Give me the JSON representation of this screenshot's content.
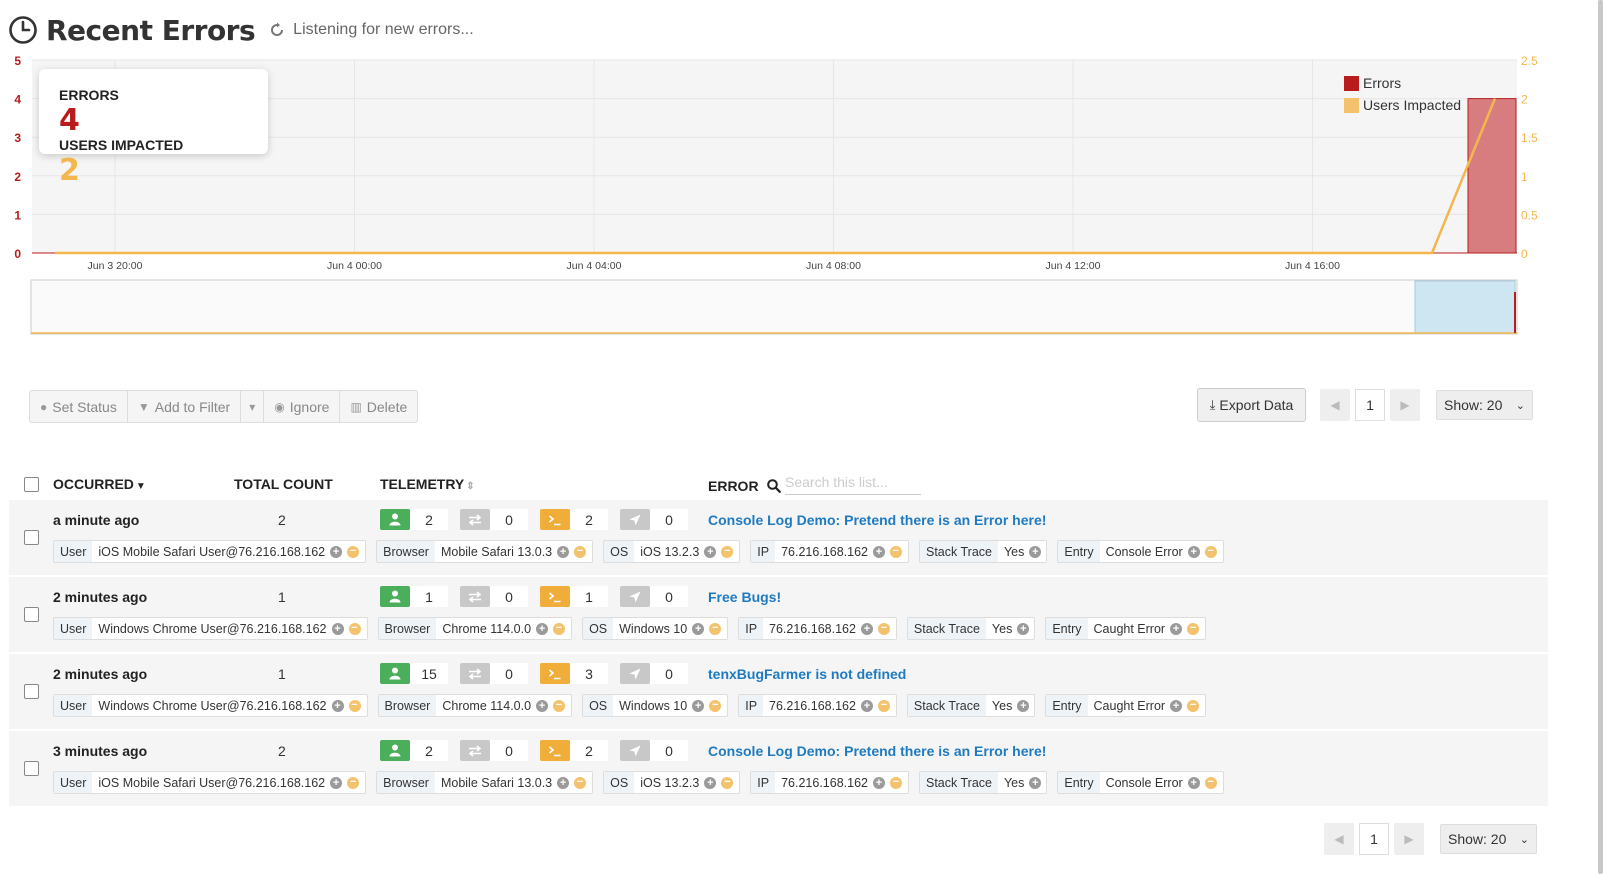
{
  "header": {
    "title": "Recent Errors",
    "status": "Listening for new errors..."
  },
  "stats": {
    "errors_label": "ERRORS",
    "errors_value": "4",
    "users_label": "USERS IMPACTED",
    "users_value": "2"
  },
  "colors": {
    "errors": "#b81c1c",
    "users": "#f4b64f",
    "link": "#1f7bc1",
    "user_badge": "#4aae5b",
    "orange_badge": "#f0ad3a",
    "gray_badge": "#c8c8c8"
  },
  "chart_data": {
    "type": "bar",
    "x": [
      "Jun 3 20:00",
      "Jun 4 00:00",
      "Jun 4 04:00",
      "Jun 4 08:00",
      "Jun 4 12:00",
      "Jun 4 16:00"
    ],
    "y_left_ticks": [
      "0",
      "1",
      "2",
      "3",
      "4",
      "5"
    ],
    "y_right_ticks": [
      "0",
      "0.5",
      "1",
      "1.5",
      "2",
      "2.5"
    ],
    "ylim_left": [
      0,
      5
    ],
    "ylim_right": [
      0,
      2.5
    ],
    "series": [
      {
        "name": "Errors",
        "type": "bar",
        "values": [
          0,
          0,
          0,
          0,
          0,
          4
        ],
        "axis": "left"
      },
      {
        "name": "Users Impacted",
        "type": "line",
        "values": [
          0,
          0,
          0,
          0,
          0,
          2
        ],
        "axis": "right"
      }
    ],
    "legend_position": "top-right",
    "grid": true
  },
  "legend": {
    "errors": "Errors",
    "users": "Users Impacted"
  },
  "toolbar": {
    "set_status": "Set Status",
    "add_to_filter": "Add to Filter",
    "ignore": "Ignore",
    "delete": "Delete",
    "export": "Export Data"
  },
  "pager": {
    "page": "1",
    "show": "Show: 20"
  },
  "table": {
    "col_occurred": "OCCURRED",
    "col_total": "TOTAL COUNT",
    "col_telemetry": "TELEMETRY",
    "col_error": "ERROR",
    "search_placeholder": "Search this list...",
    "rows": [
      {
        "occurred": "a minute ago",
        "count": "2",
        "t_user": "2",
        "t_net": "0",
        "t_console": "2",
        "t_nav": "0",
        "error": "Console Log Demo: Pretend there is an Error here!",
        "user_k": "User",
        "user_v": "iOS Mobile Safari User@76.216.168.162",
        "browser_k": "Browser",
        "browser_v": "Mobile Safari 13.0.3",
        "os_k": "OS",
        "os_v": "iOS 13.2.3",
        "ip_k": "IP",
        "ip_v": "76.216.168.162",
        "stack_k": "Stack Trace",
        "stack_v": "Yes",
        "entry_k": "Entry",
        "entry_v": "Console Error"
      },
      {
        "occurred": "2 minutes ago",
        "count": "1",
        "t_user": "1",
        "t_net": "0",
        "t_console": "1",
        "t_nav": "0",
        "error": "Free Bugs!",
        "user_k": "User",
        "user_v": "Windows Chrome User@76.216.168.162",
        "browser_k": "Browser",
        "browser_v": "Chrome 114.0.0",
        "os_k": "OS",
        "os_v": "Windows 10",
        "ip_k": "IP",
        "ip_v": "76.216.168.162",
        "stack_k": "Stack Trace",
        "stack_v": "Yes",
        "entry_k": "Entry",
        "entry_v": "Caught Error"
      },
      {
        "occurred": "2 minutes ago",
        "count": "1",
        "t_user": "15",
        "t_net": "0",
        "t_console": "3",
        "t_nav": "0",
        "error": "tenxBugFarmer is not defined",
        "user_k": "User",
        "user_v": "Windows Chrome User@76.216.168.162",
        "browser_k": "Browser",
        "browser_v": "Chrome 114.0.0",
        "os_k": "OS",
        "os_v": "Windows 10",
        "ip_k": "IP",
        "ip_v": "76.216.168.162",
        "stack_k": "Stack Trace",
        "stack_v": "Yes",
        "entry_k": "Entry",
        "entry_v": "Caught Error"
      },
      {
        "occurred": "3 minutes ago",
        "count": "2",
        "t_user": "2",
        "t_net": "0",
        "t_console": "2",
        "t_nav": "0",
        "error": "Console Log Demo: Pretend there is an Error here!",
        "user_k": "User",
        "user_v": "iOS Mobile Safari User@76.216.168.162",
        "browser_k": "Browser",
        "browser_v": "Mobile Safari 13.0.3",
        "os_k": "OS",
        "os_v": "iOS 13.2.3",
        "ip_k": "IP",
        "ip_v": "76.216.168.162",
        "stack_k": "Stack Trace",
        "stack_v": "Yes",
        "entry_k": "Entry",
        "entry_v": "Console Error"
      }
    ]
  }
}
